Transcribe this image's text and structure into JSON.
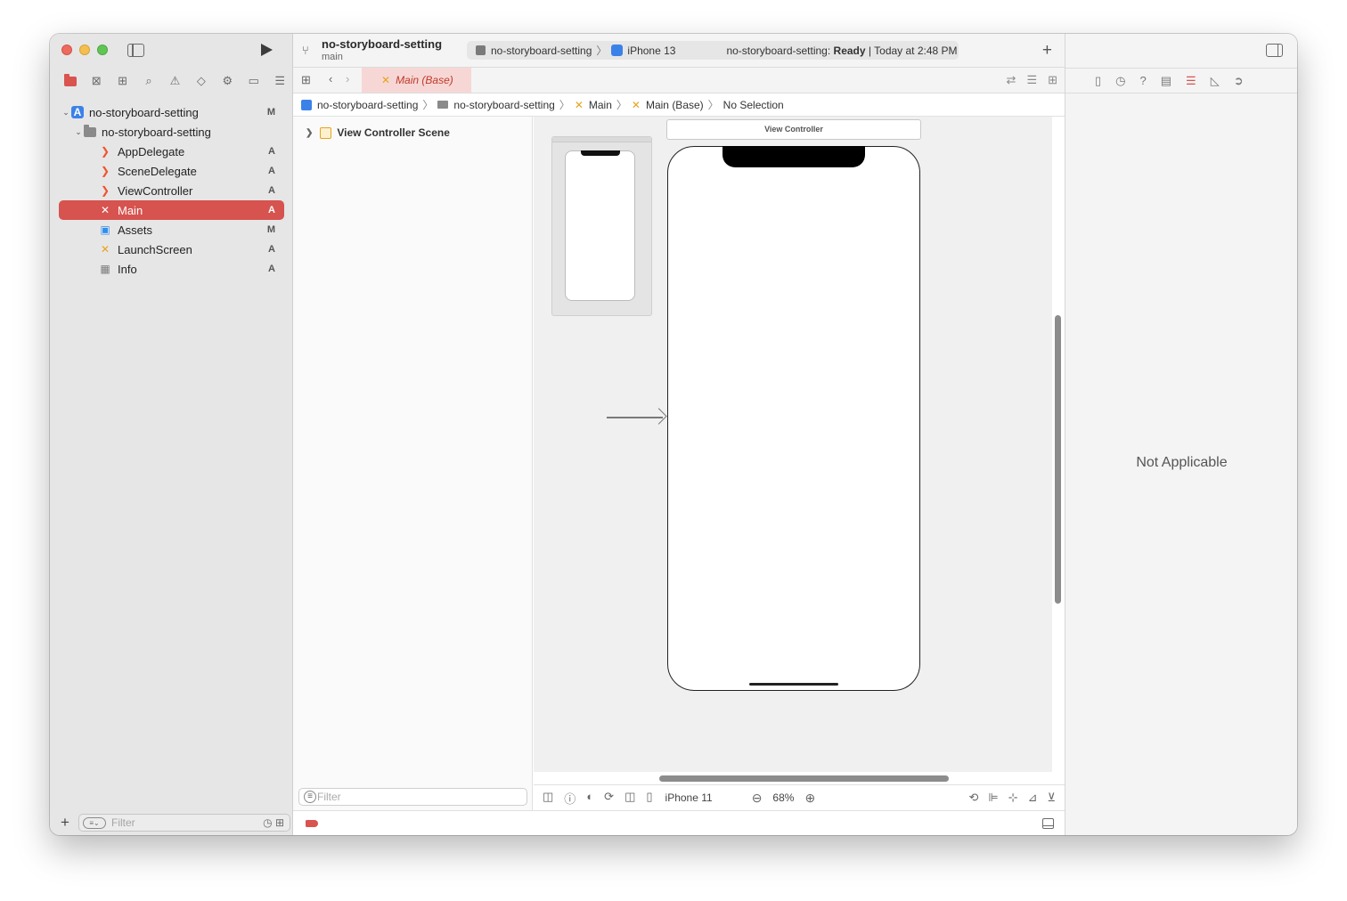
{
  "sidebar": {
    "tree": [
      {
        "label": "no-storyboard-setting",
        "badge": "M"
      },
      {
        "label": "no-storyboard-setting",
        "badge": ""
      },
      {
        "label": "AppDelegate",
        "badge": "A"
      },
      {
        "label": "SceneDelegate",
        "badge": "A"
      },
      {
        "label": "ViewController",
        "badge": "A"
      },
      {
        "label": "Main",
        "badge": "A"
      },
      {
        "label": "Assets",
        "badge": "M"
      },
      {
        "label": "LaunchScreen",
        "badge": "A"
      },
      {
        "label": "Info",
        "badge": "A"
      }
    ],
    "filter_placeholder": "Filter"
  },
  "titlebar": {
    "project": "no-storyboard-setting",
    "branch": "main",
    "scheme": "no-storyboard-setting",
    "device": "iPhone 13",
    "status_prefix": "no-storyboard-setting:",
    "status_state": "Ready",
    "status_time": "| Today at 2:48 PM"
  },
  "tab": {
    "label": "Main (Base)"
  },
  "jumpbar": [
    "no-storyboard-setting",
    "no-storyboard-setting",
    "Main",
    "Main (Base)",
    "No Selection"
  ],
  "outline": {
    "scene": "View Controller Scene",
    "filter_placeholder": "Filter"
  },
  "canvas": {
    "vc_title": "View Controller"
  },
  "canvas_toolbar": {
    "device": "iPhone 11",
    "zoom": "68%"
  },
  "inspector": {
    "message": "Not Applicable"
  },
  "colors": {
    "accent": "#d6534f",
    "storyboard_icon": "#e6a41e",
    "swift_icon": "#f0532e"
  }
}
